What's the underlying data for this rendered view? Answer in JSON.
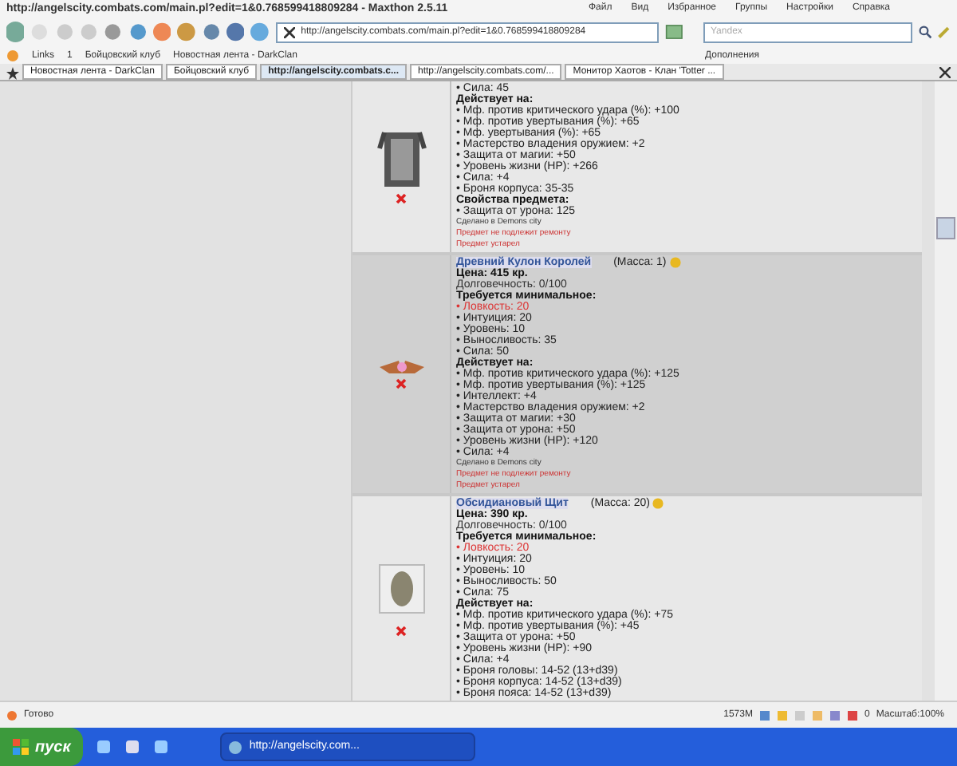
{
  "window": {
    "title": "http://angelscity.combats.com/main.pl?edit=1&0.768599418809284 - Maxthon 2.5.11",
    "menu": [
      "Файл",
      "Вид",
      "Избранное",
      "Группы",
      "Настройки",
      "Справка"
    ]
  },
  "toolbar": {
    "address": "http://angelscity.combats.com/main.pl?edit=1&0.768599418809284",
    "search_placeholder": "Yandex"
  },
  "links_bar": {
    "items": [
      "Links",
      "1",
      "Бойцовский клуб",
      "Новостная лента - DarkClan"
    ],
    "addons": "Дополнения"
  },
  "tabs": [
    {
      "label": "Новостная лента - DarkClan",
      "selected": false
    },
    {
      "label": "Бойцовский клуб",
      "selected": false
    },
    {
      "label": "http://angelscity.combats.c...",
      "selected": true
    },
    {
      "label": "http://angelscity.combats.com/...",
      "selected": false
    },
    {
      "label": "Монитор Хаотов - Клан 'Totter ...",
      "selected": false
    }
  ],
  "items": [
    {
      "lines": [
        {
          "kind": "bullet",
          "text": "• Сила: 45"
        },
        {
          "kind": "heading",
          "text": "Действует на:"
        },
        {
          "kind": "bullet",
          "text": "• Мф. против критического удара (%): +100"
        },
        {
          "kind": "bullet",
          "text": "• Мф. против увертывания (%): +65"
        },
        {
          "kind": "bullet",
          "text": "• Мф. увертывания (%): +65"
        },
        {
          "kind": "bullet",
          "text": "• Мастерство владения оружием: +2"
        },
        {
          "kind": "bullet",
          "text": "• Защита от магии: +50"
        },
        {
          "kind": "bullet",
          "text": "• Уровень жизни (HP): +266"
        },
        {
          "kind": "bullet",
          "text": "• Сила: +4"
        },
        {
          "kind": "bullet",
          "text": "• Броня корпуса: 35-35"
        },
        {
          "kind": "heading",
          "text": "Свойства предмета:"
        },
        {
          "kind": "bullet",
          "text": "• Защита от урона: 125"
        },
        {
          "kind": "note",
          "text": "Сделано в Demons city"
        },
        {
          "kind": "warning",
          "text": "Предмет не подлежит ремонту"
        },
        {
          "kind": "warning",
          "text": "Предмет устарел"
        }
      ]
    },
    {
      "name": "Древний Кулон Королей",
      "mass": "(Масса: 1)",
      "lines": [
        {
          "kind": "heading",
          "text": "Цена: 415 кр."
        },
        {
          "kind": "plain",
          "text": "Долговечность: 0/100"
        },
        {
          "kind": "heading",
          "text": "Требуется минимальное:"
        },
        {
          "kind": "unmet",
          "text": "• Ловкость: 20"
        },
        {
          "kind": "bullet",
          "text": "• Интуиция: 20"
        },
        {
          "kind": "bullet",
          "text": "• Уровень: 10"
        },
        {
          "kind": "bullet",
          "text": "• Выносливость: 35"
        },
        {
          "kind": "bullet",
          "text": "• Сила: 50"
        },
        {
          "kind": "heading",
          "text": "Действует на:"
        },
        {
          "kind": "bullet",
          "text": "• Мф. против критического удара (%): +125"
        },
        {
          "kind": "bullet",
          "text": "• Мф. против увертывания (%): +125"
        },
        {
          "kind": "bullet",
          "text": "• Интеллект: +4"
        },
        {
          "kind": "bullet",
          "text": "• Мастерство владения оружием: +2"
        },
        {
          "kind": "bullet",
          "text": "• Защита от магии: +30"
        },
        {
          "kind": "bullet",
          "text": "• Защита от урона: +50"
        },
        {
          "kind": "bullet",
          "text": "• Уровень жизни (HP): +120"
        },
        {
          "kind": "bullet",
          "text": "• Сила: +4"
        },
        {
          "kind": "note",
          "text": "Сделано в Demons city"
        },
        {
          "kind": "warning",
          "text": "Предмет не подлежит ремонту"
        },
        {
          "kind": "warning",
          "text": "Предмет устарел"
        }
      ]
    },
    {
      "name": "Обсидиановый Щит",
      "mass": "(Масса: 20)",
      "lines": [
        {
          "kind": "heading",
          "text": "Цена: 390 кр."
        },
        {
          "kind": "plain",
          "text": "Долговечность: 0/100"
        },
        {
          "kind": "heading",
          "text": "Требуется минимальное:"
        },
        {
          "kind": "unmet",
          "text": "• Ловкость: 20"
        },
        {
          "kind": "bullet",
          "text": "• Интуиция: 20"
        },
        {
          "kind": "bullet",
          "text": "• Уровень: 10"
        },
        {
          "kind": "bullet",
          "text": "• Выносливость: 50"
        },
        {
          "kind": "bullet",
          "text": "• Сила: 75"
        },
        {
          "kind": "heading",
          "text": "Действует на:"
        },
        {
          "kind": "bullet",
          "text": "• Мф. против критического удара (%): +75"
        },
        {
          "kind": "bullet",
          "text": "• Мф. против увертывания (%): +45"
        },
        {
          "kind": "bullet",
          "text": "• Защита от урона: +50"
        },
        {
          "kind": "bullet",
          "text": "• Уровень жизни (HP): +90"
        },
        {
          "kind": "bullet",
          "text": "• Сила: +4"
        },
        {
          "kind": "bullet",
          "text": "• Броня головы: 14-52 (13+d39)"
        },
        {
          "kind": "bullet",
          "text": "• Броня корпуса: 14-52 (13+d39)"
        },
        {
          "kind": "bullet",
          "text": "• Броня пояса: 14-52 (13+d39)"
        }
      ]
    }
  ],
  "status_bar": {
    "status": "Готово",
    "memory": "1573M",
    "count": "0",
    "zoom": "Масштаб:100%"
  },
  "taskbar": {
    "start": "пуск",
    "window": "http://angelscity.com..."
  }
}
